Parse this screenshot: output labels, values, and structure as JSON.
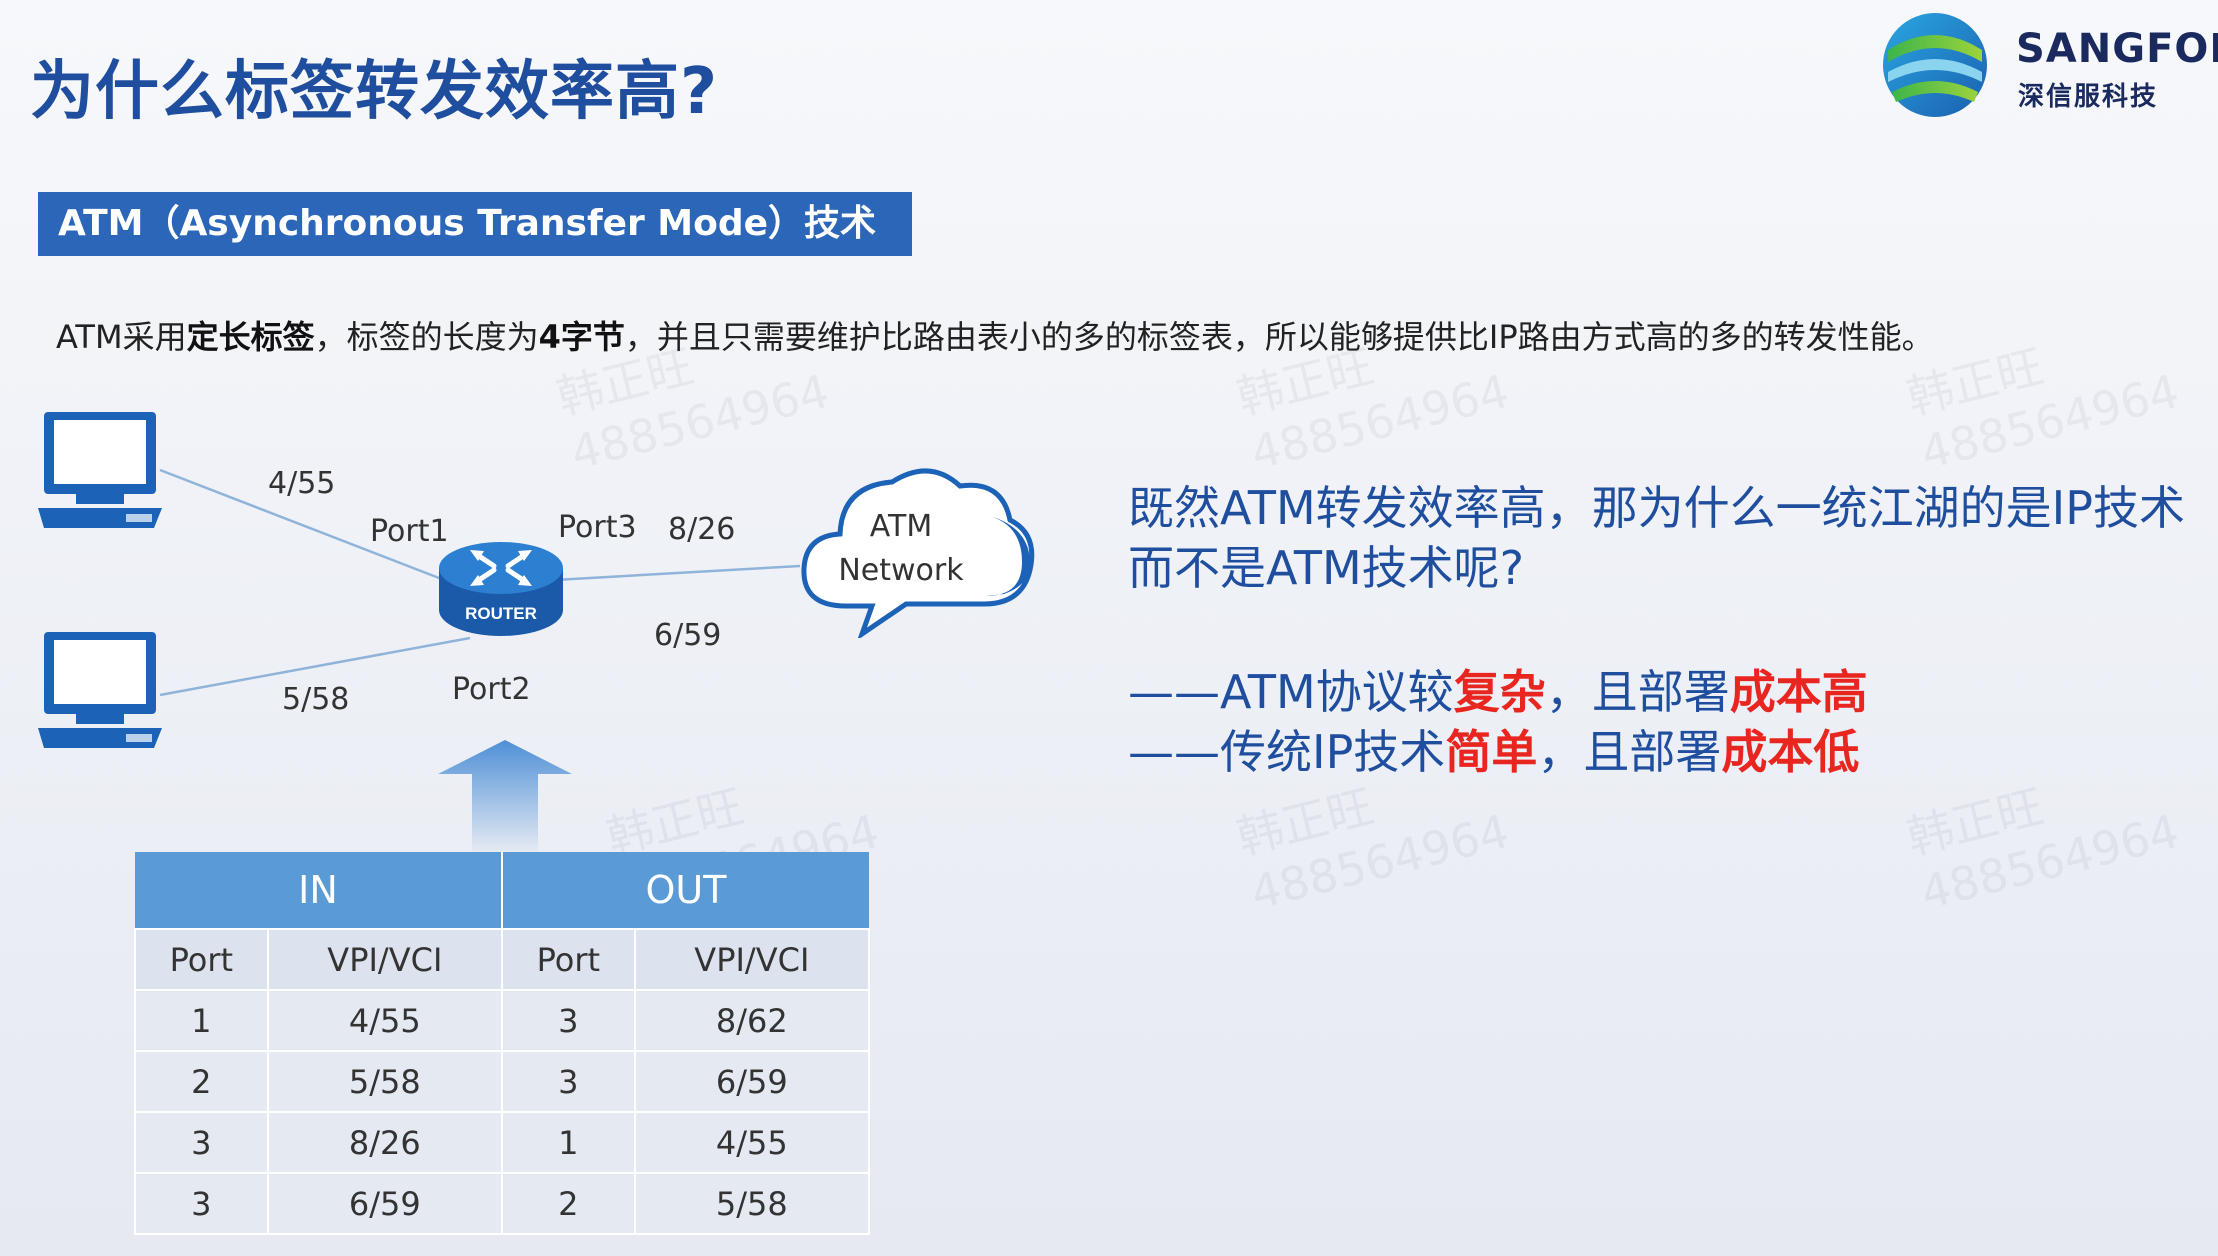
{
  "title": "为什么标签转发效率高?",
  "logo": {
    "brand": "SANGFOR",
    "brand_sub": "深信服科技"
  },
  "section": {
    "banner": "ATM（Asynchronous Transfer Mode）技术"
  },
  "description": {
    "p1": "ATM采用",
    "b1": "定长标签",
    "p2": "，标签的长度为",
    "b2": "4字节",
    "p3": "，并且只需要维护比路由表小的多的标签表，所以能够提供比IP路由方式高的多的转发性能。"
  },
  "diagram": {
    "label_4_55": "4/55",
    "label_5_58": "5/58",
    "label_8_26": "8/26",
    "label_6_59": "6/59",
    "port1": "Port1",
    "port2": "Port2",
    "port3": "Port3",
    "router_label": "ROUTER",
    "cloud_line1": "ATM",
    "cloud_line2": "Network"
  },
  "table": {
    "in_header": "IN",
    "out_header": "OUT",
    "subheaders": [
      "Port",
      "VPI/VCI",
      "Port",
      "VPI/VCI"
    ],
    "rows": [
      [
        "1",
        "4/55",
        "3",
        "8/62"
      ],
      [
        "2",
        "5/58",
        "3",
        "6/59"
      ],
      [
        "3",
        "8/26",
        "1",
        "4/55"
      ],
      [
        "3",
        "6/59",
        "2",
        "5/58"
      ]
    ]
  },
  "right": {
    "question": "既然ATM转发效率高，那为什么一统江湖的是IP技术而不是ATM技术呢?",
    "point1": {
      "a": "——ATM协议较",
      "b": "复杂",
      "c": "，且部署",
      "d": "成本高"
    },
    "point2": {
      "a": "——传统IP技术",
      "b": "简单",
      "c": "，且部署",
      "d": "成本低"
    }
  },
  "watermark": {
    "name": "韩正旺",
    "id": "488564964"
  },
  "colors": {
    "title": "#1f4e9e",
    "banner": "#2b66b8",
    "table_header": "#5b9bd5",
    "emphasis": "#e8251f"
  }
}
